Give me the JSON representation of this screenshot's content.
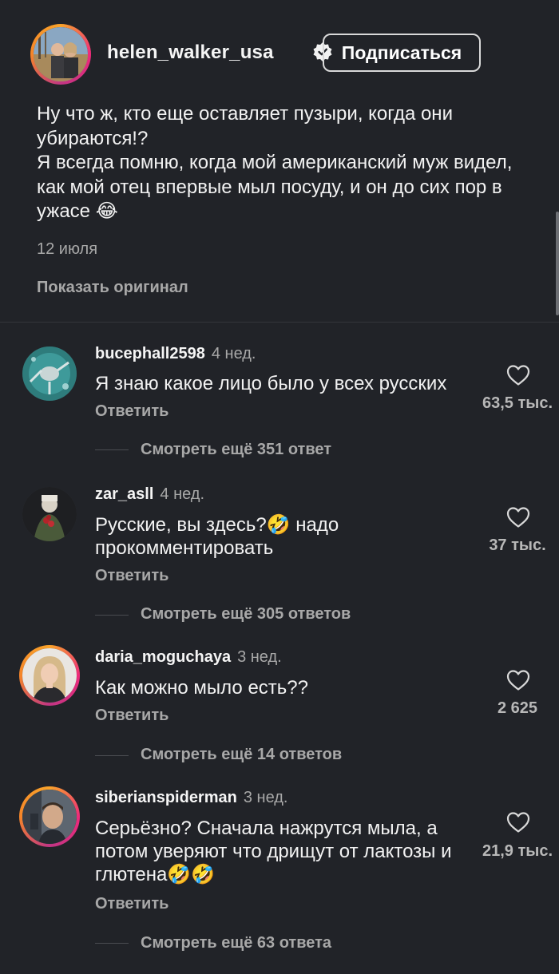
{
  "post": {
    "username": "helen_walker_usa",
    "subscribe_label": "Подписаться",
    "caption": "Ну что ж, кто еще оставляет пузыри, когда они убираются!?\n Я всегда помню, когда мой американский муж видел, как мой отец впервые мыл посуду, и он до сих пор в ужасе 😂",
    "date": "12 июля",
    "show_original": "Показать оригинал"
  },
  "comments": [
    {
      "username": "bucephall2598",
      "time": "4 нед.",
      "text": "Я знаю какое лицо было у всех русских",
      "reply_label": "Ответить",
      "likes": "63,5 тыс.",
      "more_replies": "Смотреть ещё 351 ответ"
    },
    {
      "username": "zar_asll",
      "time": "4 нед.",
      "text": "Русские, вы здесь?🤣 надо прокомментировать",
      "reply_label": "Ответить",
      "likes": "37 тыс.",
      "more_replies": "Смотреть ещё 305 ответов"
    },
    {
      "username": "daria_moguchaya",
      "time": "3 нед.",
      "text": "Как можно мыло есть??",
      "reply_label": "Ответить",
      "likes": "2 625",
      "more_replies": "Смотреть ещё 14 ответов"
    },
    {
      "username": "siberianspiderman",
      "time": "3 нед.",
      "text": "Серьёзно? Сначала нажрутся мыла, а потом уверяют что дрищут от лактозы и глютена🤣🤣",
      "reply_label": "Ответить",
      "likes": "21,9 тыс.",
      "more_replies": "Смотреть ещё 63 ответа"
    }
  ],
  "icons": {
    "verified": "verified-badge-icon",
    "like": "heart-outline-icon"
  },
  "colors": {
    "background": "#212328",
    "text_primary": "#f5f5f5",
    "text_secondary": "#a8a8a8",
    "story_ring": "#ee2a7b"
  }
}
